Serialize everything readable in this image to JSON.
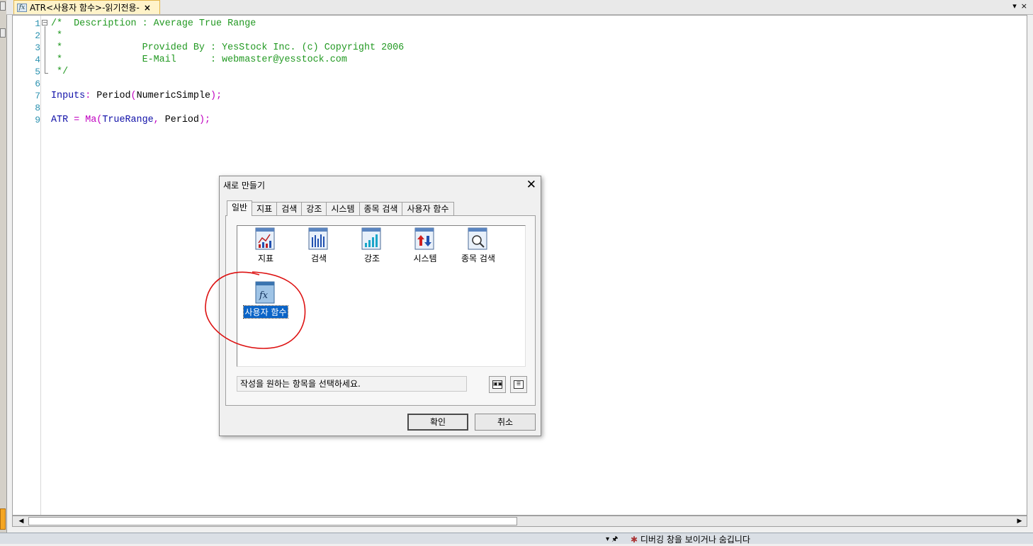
{
  "document_tab": {
    "icon": "fx-function-icon",
    "title": "ATR<사용자 함수>-읽기전용-",
    "close_glyph": "×"
  },
  "tabbar_controls": {
    "dropdown_glyph": "▾",
    "close_glyph": "×"
  },
  "editor": {
    "lines": [
      {
        "n": "1",
        "parts": [
          {
            "t": "/*  Description : Average True Range",
            "c": "com"
          }
        ]
      },
      {
        "n": "2",
        "parts": [
          {
            "t": " *",
            "c": "com"
          }
        ]
      },
      {
        "n": "3",
        "parts": [
          {
            "t": " *              Provided By : YesStock Inc. (c) Copyright 2006",
            "c": "com"
          }
        ]
      },
      {
        "n": "4",
        "parts": [
          {
            "t": " *              E-Mail      : webmaster@yesstock.com",
            "c": "com"
          }
        ]
      },
      {
        "n": "5",
        "parts": [
          {
            "t": " */",
            "c": "com"
          }
        ]
      },
      {
        "n": "6",
        "parts": []
      },
      {
        "n": "7",
        "parts": [
          {
            "t": "Inputs",
            "c": "kw"
          },
          {
            "t": ": ",
            "c": "op"
          },
          {
            "t": "Period",
            "c": "id"
          },
          {
            "t": "(",
            "c": "op"
          },
          {
            "t": "NumericSimple",
            "c": "id"
          },
          {
            "t": ");",
            "c": "op"
          }
        ]
      },
      {
        "n": "8",
        "parts": []
      },
      {
        "n": "9",
        "parts": [
          {
            "t": "ATR",
            "c": "kw"
          },
          {
            "t": " = ",
            "c": "op"
          },
          {
            "t": "Ma",
            "c": "op"
          },
          {
            "t": "(",
            "c": "op"
          },
          {
            "t": "TrueRange",
            "c": "kw"
          },
          {
            "t": ", ",
            "c": "op"
          },
          {
            "t": "Period",
            "c": "id"
          },
          {
            "t": ");",
            "c": "op"
          }
        ]
      }
    ]
  },
  "dialog": {
    "title": "새로 만들기",
    "close_glyph": "✕",
    "tabs": [
      "일반",
      "지표",
      "검색",
      "강조",
      "시스템",
      "종목 검색",
      "사용자 함수"
    ],
    "active_tab": "일반",
    "items": [
      {
        "label": "지표",
        "icon": "indicator-chart-icon"
      },
      {
        "label": "검색",
        "icon": "search-bars-icon"
      },
      {
        "label": "강조",
        "icon": "highlight-bars-icon"
      },
      {
        "label": "시스템",
        "icon": "system-arrows-icon"
      },
      {
        "label": "종목 검색",
        "icon": "stock-search-magnifier-icon"
      },
      {
        "label": "사용자 함수",
        "icon": "user-function-fx-icon"
      }
    ],
    "selected_item": "사용자 함수",
    "status_text": "작성을 원하는 항목을 선택하세요.",
    "ok_label": "확인",
    "cancel_label": "취소"
  },
  "bottom_bar": {
    "message": "디버깅 창을 보이거나 숨깁니다"
  },
  "colors": {
    "comment": "#229922",
    "keyword": "#1010a8",
    "operator": "#c000c0",
    "line_number": "#2b91af",
    "annotation_circle": "#dd1111",
    "selection": "#0a64c8"
  }
}
